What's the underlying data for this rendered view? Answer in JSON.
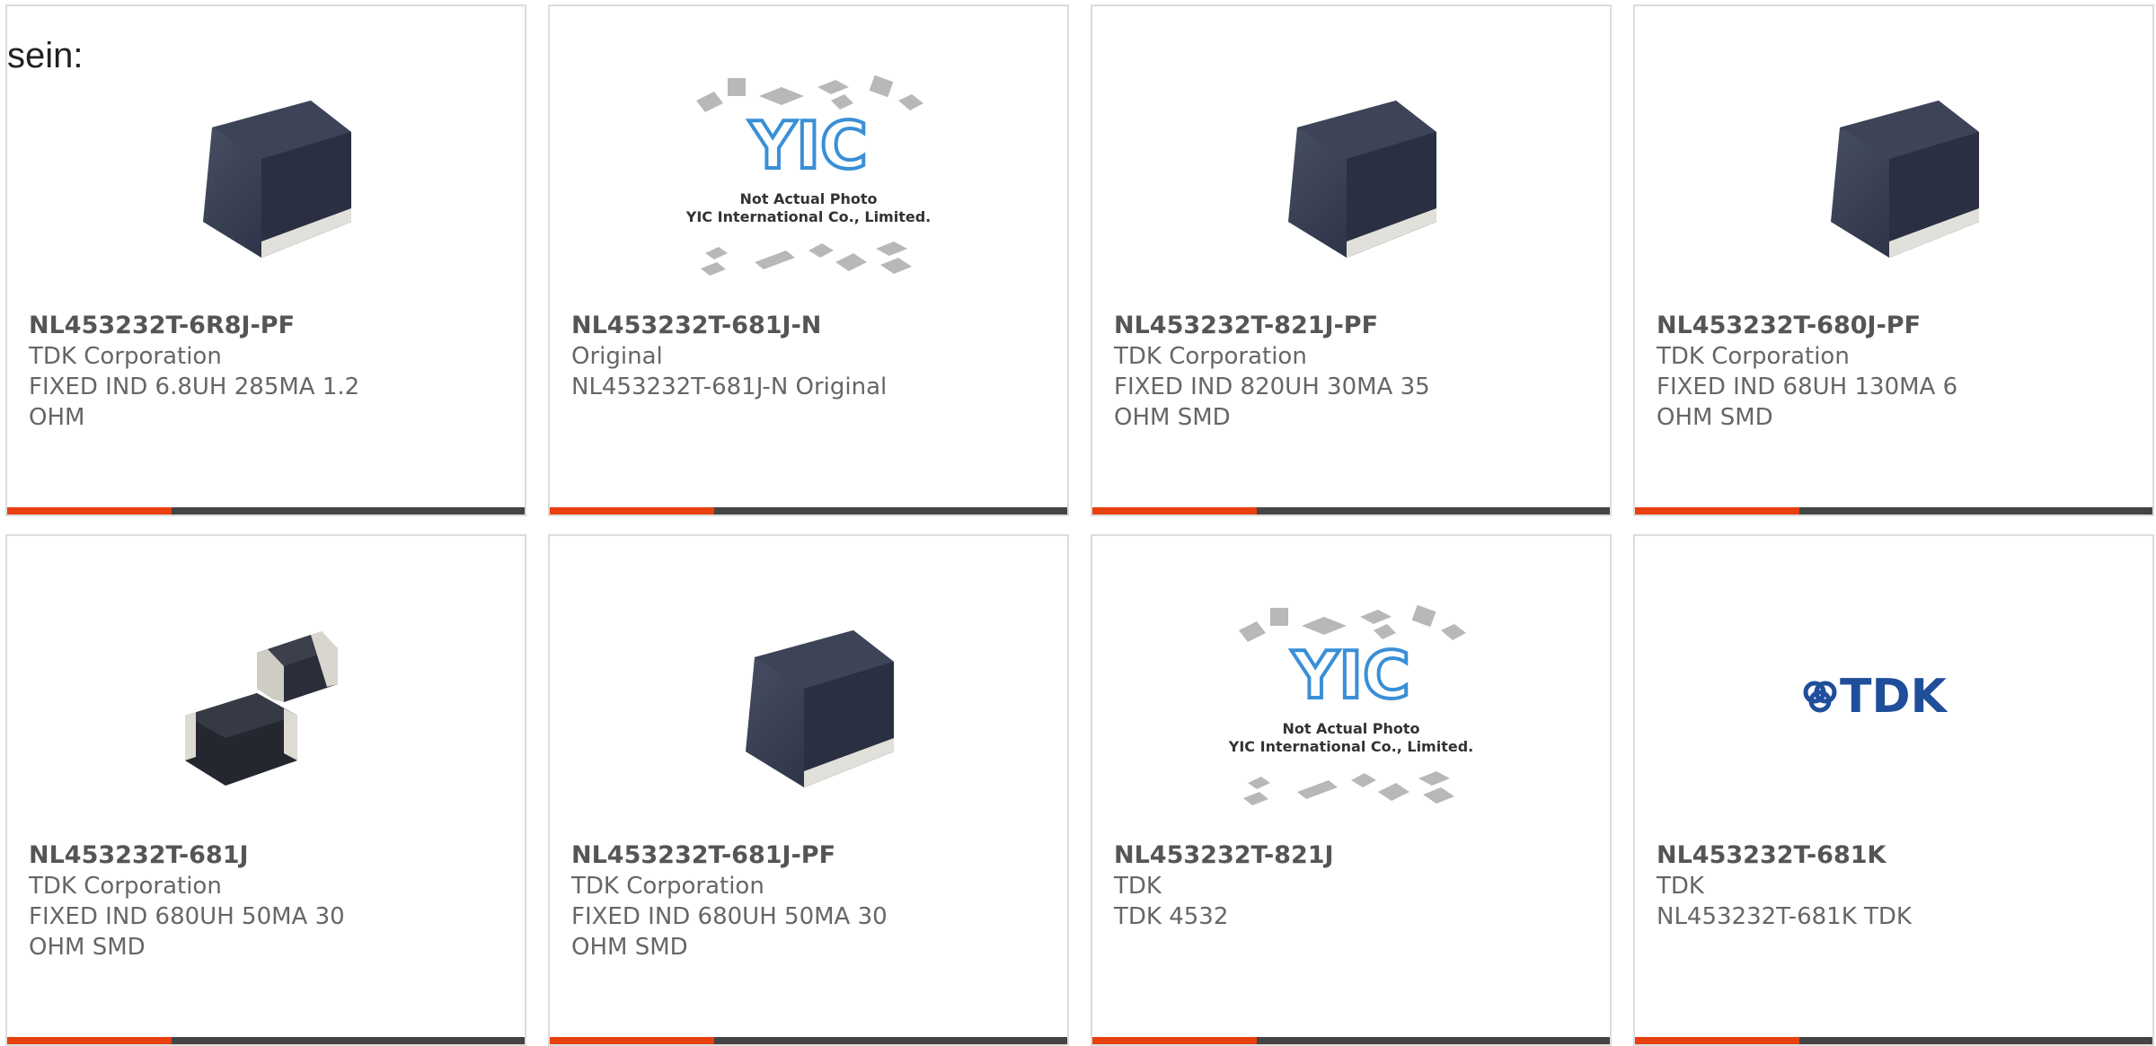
{
  "intro_text": "sein:",
  "yic_logo_text": "YIC",
  "yic_note_line1": "Not Actual Photo",
  "yic_note_line2": "YIC International Co., Limited.",
  "tdk_logo_text": "TDK",
  "products": [
    {
      "part_number": "NL453232T-6R8J-PF",
      "manufacturer": "TDK Corporation",
      "description": "FIXED IND 6.8UH 285MA 1.2 OHM",
      "image": "inductor-black-chip"
    },
    {
      "part_number": "NL453232T-681J-N",
      "manufacturer": "Original",
      "description": "NL453232T-681J-N Original",
      "image": "yic-placeholder"
    },
    {
      "part_number": "NL453232T-821J-PF",
      "manufacturer": "TDK Corporation",
      "description": "FIXED IND 820UH 30MA 35 OHM SMD",
      "image": "inductor-black-chip"
    },
    {
      "part_number": "NL453232T-680J-PF",
      "manufacturer": "TDK Corporation",
      "description": "FIXED IND 68UH 130MA 6 OHM SMD",
      "image": "inductor-black-chip"
    },
    {
      "part_number": "NL453232T-681J",
      "manufacturer": "TDK Corporation",
      "description": "FIXED IND 680UH 50MA 30 OHM SMD",
      "image": "inductor-pair"
    },
    {
      "part_number": "NL453232T-681J-PF",
      "manufacturer": "TDK Corporation",
      "description": "FIXED IND 680UH 50MA 30 OHM SMD",
      "image": "inductor-black-chip"
    },
    {
      "part_number": "NL453232T-821J",
      "manufacturer": "TDK",
      "description": "TDK 4532",
      "image": "yic-placeholder"
    },
    {
      "part_number": "NL453232T-681K",
      "manufacturer": "TDK",
      "description": "NL453232T-681K TDK",
      "image": "tdk-logo"
    }
  ],
  "colors": {
    "accent": "#e8400e",
    "bar": "#444444",
    "border": "#dcdcdc",
    "text": "#666666"
  }
}
